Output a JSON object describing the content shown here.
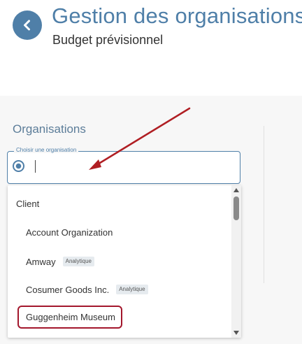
{
  "header": {
    "title": "Gestion des organisations",
    "subtitle": "Budget prévisionnel",
    "back_icon": "chevron-left-icon"
  },
  "section": {
    "title": "Organisations"
  },
  "org_field": {
    "legend": "Choisir une organisation",
    "value": "",
    "icon": "target-icon"
  },
  "dropdown": {
    "group_label": "Client",
    "options": [
      {
        "label": "Account Organization",
        "badge": ""
      },
      {
        "label": "Amway",
        "badge": "Analytique"
      },
      {
        "label": "Cosumer Goods Inc.",
        "badge": "Analytique"
      },
      {
        "label": "Guggenheim Museum",
        "badge": ""
      }
    ]
  },
  "colors": {
    "accent": "#4f7fa8",
    "highlight": "#a3172c",
    "annotation_arrow": "#b01e23"
  }
}
